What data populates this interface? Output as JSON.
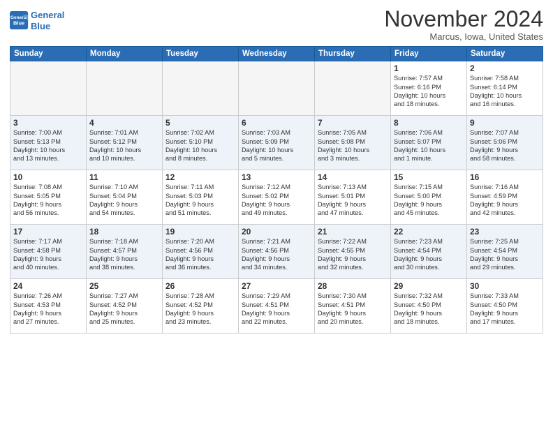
{
  "header": {
    "logo_line1": "General",
    "logo_line2": "Blue",
    "month": "November 2024",
    "location": "Marcus, Iowa, United States"
  },
  "days_of_week": [
    "Sunday",
    "Monday",
    "Tuesday",
    "Wednesday",
    "Thursday",
    "Friday",
    "Saturday"
  ],
  "weeks": [
    [
      {
        "day": "",
        "info": ""
      },
      {
        "day": "",
        "info": ""
      },
      {
        "day": "",
        "info": ""
      },
      {
        "day": "",
        "info": ""
      },
      {
        "day": "",
        "info": ""
      },
      {
        "day": "1",
        "info": "Sunrise: 7:57 AM\nSunset: 6:16 PM\nDaylight: 10 hours\nand 18 minutes."
      },
      {
        "day": "2",
        "info": "Sunrise: 7:58 AM\nSunset: 6:14 PM\nDaylight: 10 hours\nand 16 minutes."
      }
    ],
    [
      {
        "day": "3",
        "info": "Sunrise: 7:00 AM\nSunset: 5:13 PM\nDaylight: 10 hours\nand 13 minutes."
      },
      {
        "day": "4",
        "info": "Sunrise: 7:01 AM\nSunset: 5:12 PM\nDaylight: 10 hours\nand 10 minutes."
      },
      {
        "day": "5",
        "info": "Sunrise: 7:02 AM\nSunset: 5:10 PM\nDaylight: 10 hours\nand 8 minutes."
      },
      {
        "day": "6",
        "info": "Sunrise: 7:03 AM\nSunset: 5:09 PM\nDaylight: 10 hours\nand 5 minutes."
      },
      {
        "day": "7",
        "info": "Sunrise: 7:05 AM\nSunset: 5:08 PM\nDaylight: 10 hours\nand 3 minutes."
      },
      {
        "day": "8",
        "info": "Sunrise: 7:06 AM\nSunset: 5:07 PM\nDaylight: 10 hours\nand 1 minute."
      },
      {
        "day": "9",
        "info": "Sunrise: 7:07 AM\nSunset: 5:06 PM\nDaylight: 9 hours\nand 58 minutes."
      }
    ],
    [
      {
        "day": "10",
        "info": "Sunrise: 7:08 AM\nSunset: 5:05 PM\nDaylight: 9 hours\nand 56 minutes."
      },
      {
        "day": "11",
        "info": "Sunrise: 7:10 AM\nSunset: 5:04 PM\nDaylight: 9 hours\nand 54 minutes."
      },
      {
        "day": "12",
        "info": "Sunrise: 7:11 AM\nSunset: 5:03 PM\nDaylight: 9 hours\nand 51 minutes."
      },
      {
        "day": "13",
        "info": "Sunrise: 7:12 AM\nSunset: 5:02 PM\nDaylight: 9 hours\nand 49 minutes."
      },
      {
        "day": "14",
        "info": "Sunrise: 7:13 AM\nSunset: 5:01 PM\nDaylight: 9 hours\nand 47 minutes."
      },
      {
        "day": "15",
        "info": "Sunrise: 7:15 AM\nSunset: 5:00 PM\nDaylight: 9 hours\nand 45 minutes."
      },
      {
        "day": "16",
        "info": "Sunrise: 7:16 AM\nSunset: 4:59 PM\nDaylight: 9 hours\nand 42 minutes."
      }
    ],
    [
      {
        "day": "17",
        "info": "Sunrise: 7:17 AM\nSunset: 4:58 PM\nDaylight: 9 hours\nand 40 minutes."
      },
      {
        "day": "18",
        "info": "Sunrise: 7:18 AM\nSunset: 4:57 PM\nDaylight: 9 hours\nand 38 minutes."
      },
      {
        "day": "19",
        "info": "Sunrise: 7:20 AM\nSunset: 4:56 PM\nDaylight: 9 hours\nand 36 minutes."
      },
      {
        "day": "20",
        "info": "Sunrise: 7:21 AM\nSunset: 4:56 PM\nDaylight: 9 hours\nand 34 minutes."
      },
      {
        "day": "21",
        "info": "Sunrise: 7:22 AM\nSunset: 4:55 PM\nDaylight: 9 hours\nand 32 minutes."
      },
      {
        "day": "22",
        "info": "Sunrise: 7:23 AM\nSunset: 4:54 PM\nDaylight: 9 hours\nand 30 minutes."
      },
      {
        "day": "23",
        "info": "Sunrise: 7:25 AM\nSunset: 4:54 PM\nDaylight: 9 hours\nand 29 minutes."
      }
    ],
    [
      {
        "day": "24",
        "info": "Sunrise: 7:26 AM\nSunset: 4:53 PM\nDaylight: 9 hours\nand 27 minutes."
      },
      {
        "day": "25",
        "info": "Sunrise: 7:27 AM\nSunset: 4:52 PM\nDaylight: 9 hours\nand 25 minutes."
      },
      {
        "day": "26",
        "info": "Sunrise: 7:28 AM\nSunset: 4:52 PM\nDaylight: 9 hours\nand 23 minutes."
      },
      {
        "day": "27",
        "info": "Sunrise: 7:29 AM\nSunset: 4:51 PM\nDaylight: 9 hours\nand 22 minutes."
      },
      {
        "day": "28",
        "info": "Sunrise: 7:30 AM\nSunset: 4:51 PM\nDaylight: 9 hours\nand 20 minutes."
      },
      {
        "day": "29",
        "info": "Sunrise: 7:32 AM\nSunset: 4:50 PM\nDaylight: 9 hours\nand 18 minutes."
      },
      {
        "day": "30",
        "info": "Sunrise: 7:33 AM\nSunset: 4:50 PM\nDaylight: 9 hours\nand 17 minutes."
      }
    ]
  ]
}
